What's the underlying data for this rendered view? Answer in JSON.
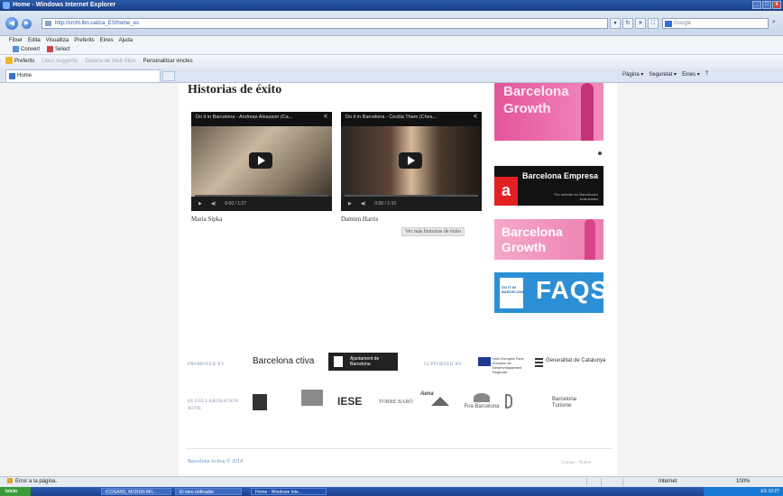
{
  "window": {
    "title": "Home - Windows Internet Explorer",
    "controls": [
      "_",
      "□",
      "x"
    ]
  },
  "address_bar": {
    "back": "◀",
    "forward": "▶",
    "url": "http://crcht.lbn.cat/ca_ES/home_es",
    "tools": [
      "▾",
      "↻",
      "✕",
      "⛶"
    ],
    "search_placeholder": "Google",
    "search_button": "⌕"
  },
  "menu": {
    "items": [
      "Fitxer",
      "Edita",
      "Visualitza",
      "Preferits",
      "Eines",
      "Ajuda"
    ],
    "tools": [
      "Convert",
      "Select"
    ]
  },
  "favorites_bar": {
    "favorites_label": "Preferits",
    "items": [
      "Llocs suggerits",
      "Galeria de Web Slice",
      "Personalitzar vincles"
    ]
  },
  "tab": {
    "label": "Home",
    "command_bar": [
      "Pàgina ▾",
      "Seguretat ▾",
      "Eines ▾",
      "?"
    ]
  },
  "page": {
    "heading": "Historias de éxito",
    "videos": [
      {
        "title": "Do it in Barcelona - Andreas Aleasson (Ca...",
        "time": "0:00 / 1:27",
        "caption": "Maria Sipka"
      },
      {
        "title": "Do it in Barcelona - Cecilia Tham (Ches...",
        "time": "0:00 / 1:10",
        "caption": "Damien Harris"
      }
    ],
    "more_button": "Ver más historias de éxito",
    "banners": {
      "growth1": "Barcelona Growth",
      "empresa_title": "Barcelona Empresa",
      "empresa_letter": "a",
      "empresa_sub": "The website for Barcelona's businesses",
      "growth2": "Barcelona Growth",
      "faqs": "FAQS",
      "faqs_badge": "DO IT IN BARCELONA"
    },
    "footer": {
      "promoted_label": "PROMOTED BY",
      "supported_label": "SUPPORTED BY",
      "collab_label": "IN COLLABORATION WITH",
      "barcelona_activa": "Barcelona ctiva",
      "ajuntament": "Ajuntament de Barcelona",
      "ue": "Unió Europea Fons Europeu de Desenvolupament Regional",
      "generalitat": "Generalitat de Catalunya",
      "iese": "IESE",
      "torre": "TORRE BARÒ",
      "aena": "Aena",
      "fira": "Fira Barcelona",
      "turisme": "Barcelona Turisme",
      "copyright": "Barcelona Activa © 2014",
      "contact": "Contact · Notice"
    }
  },
  "status_bar": {
    "text": "Error a la pàgina.",
    "zone": "Internet",
    "zoom": "100%"
  },
  "taskbar": {
    "start": "Inicio",
    "items": [
      "ICOSANS_MCRSN MII...",
      "El meu ordinador",
      "Home - Windows Inte..."
    ],
    "clock": "ES 10:27"
  }
}
